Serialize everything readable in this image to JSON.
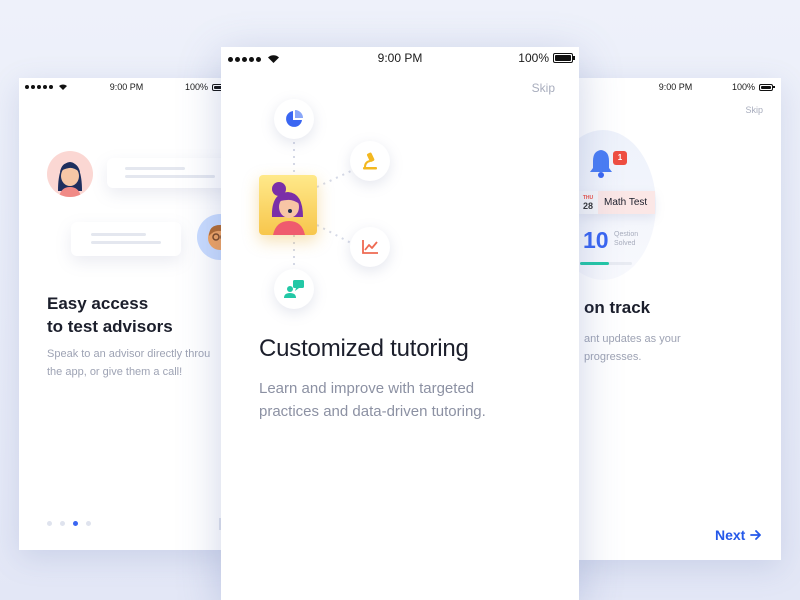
{
  "screens": {
    "left": {
      "status": {
        "time": "9:00 PM",
        "battery": "100%"
      },
      "title_line1": "Easy access",
      "title_line2": "to test advisors",
      "body_line1": "Speak to an advisor directly throu",
      "body_line2": "the app, or give them a call!",
      "page_indicator": {
        "count": 4,
        "active_index": 2
      }
    },
    "center": {
      "status": {
        "time": "9:00 PM",
        "battery": "100%"
      },
      "skip_label": "Skip",
      "icons": [
        "pie-chart-icon",
        "microscope-icon",
        "line-chart-icon",
        "chat-user-icon",
        "tutor-avatar-icon"
      ],
      "title": "Customized tutoring",
      "body_line1": "Learn and improve with targeted",
      "body_line2": "practices and data-driven tutoring."
    },
    "right": {
      "status": {
        "time": "9:00 PM",
        "battery": "100%"
      },
      "skip_label": "Skip",
      "notification_badge": "1",
      "calendar": {
        "day_of_week": "THU",
        "day": "28",
        "event": "Math Test"
      },
      "questions": {
        "count": "10",
        "label_line1": "Qestion",
        "label_line2": "Solved",
        "progress": 0.55
      },
      "title": "on track",
      "body_line1": "ant updates as your",
      "body_line2": "progresses.",
      "next_label": "Next"
    }
  },
  "colors": {
    "accent": "#3a66f2",
    "next": "#2458e9",
    "badge": "#ef4e41",
    "progress": "#23c8a6",
    "tutor_card": "#f7c64c"
  }
}
